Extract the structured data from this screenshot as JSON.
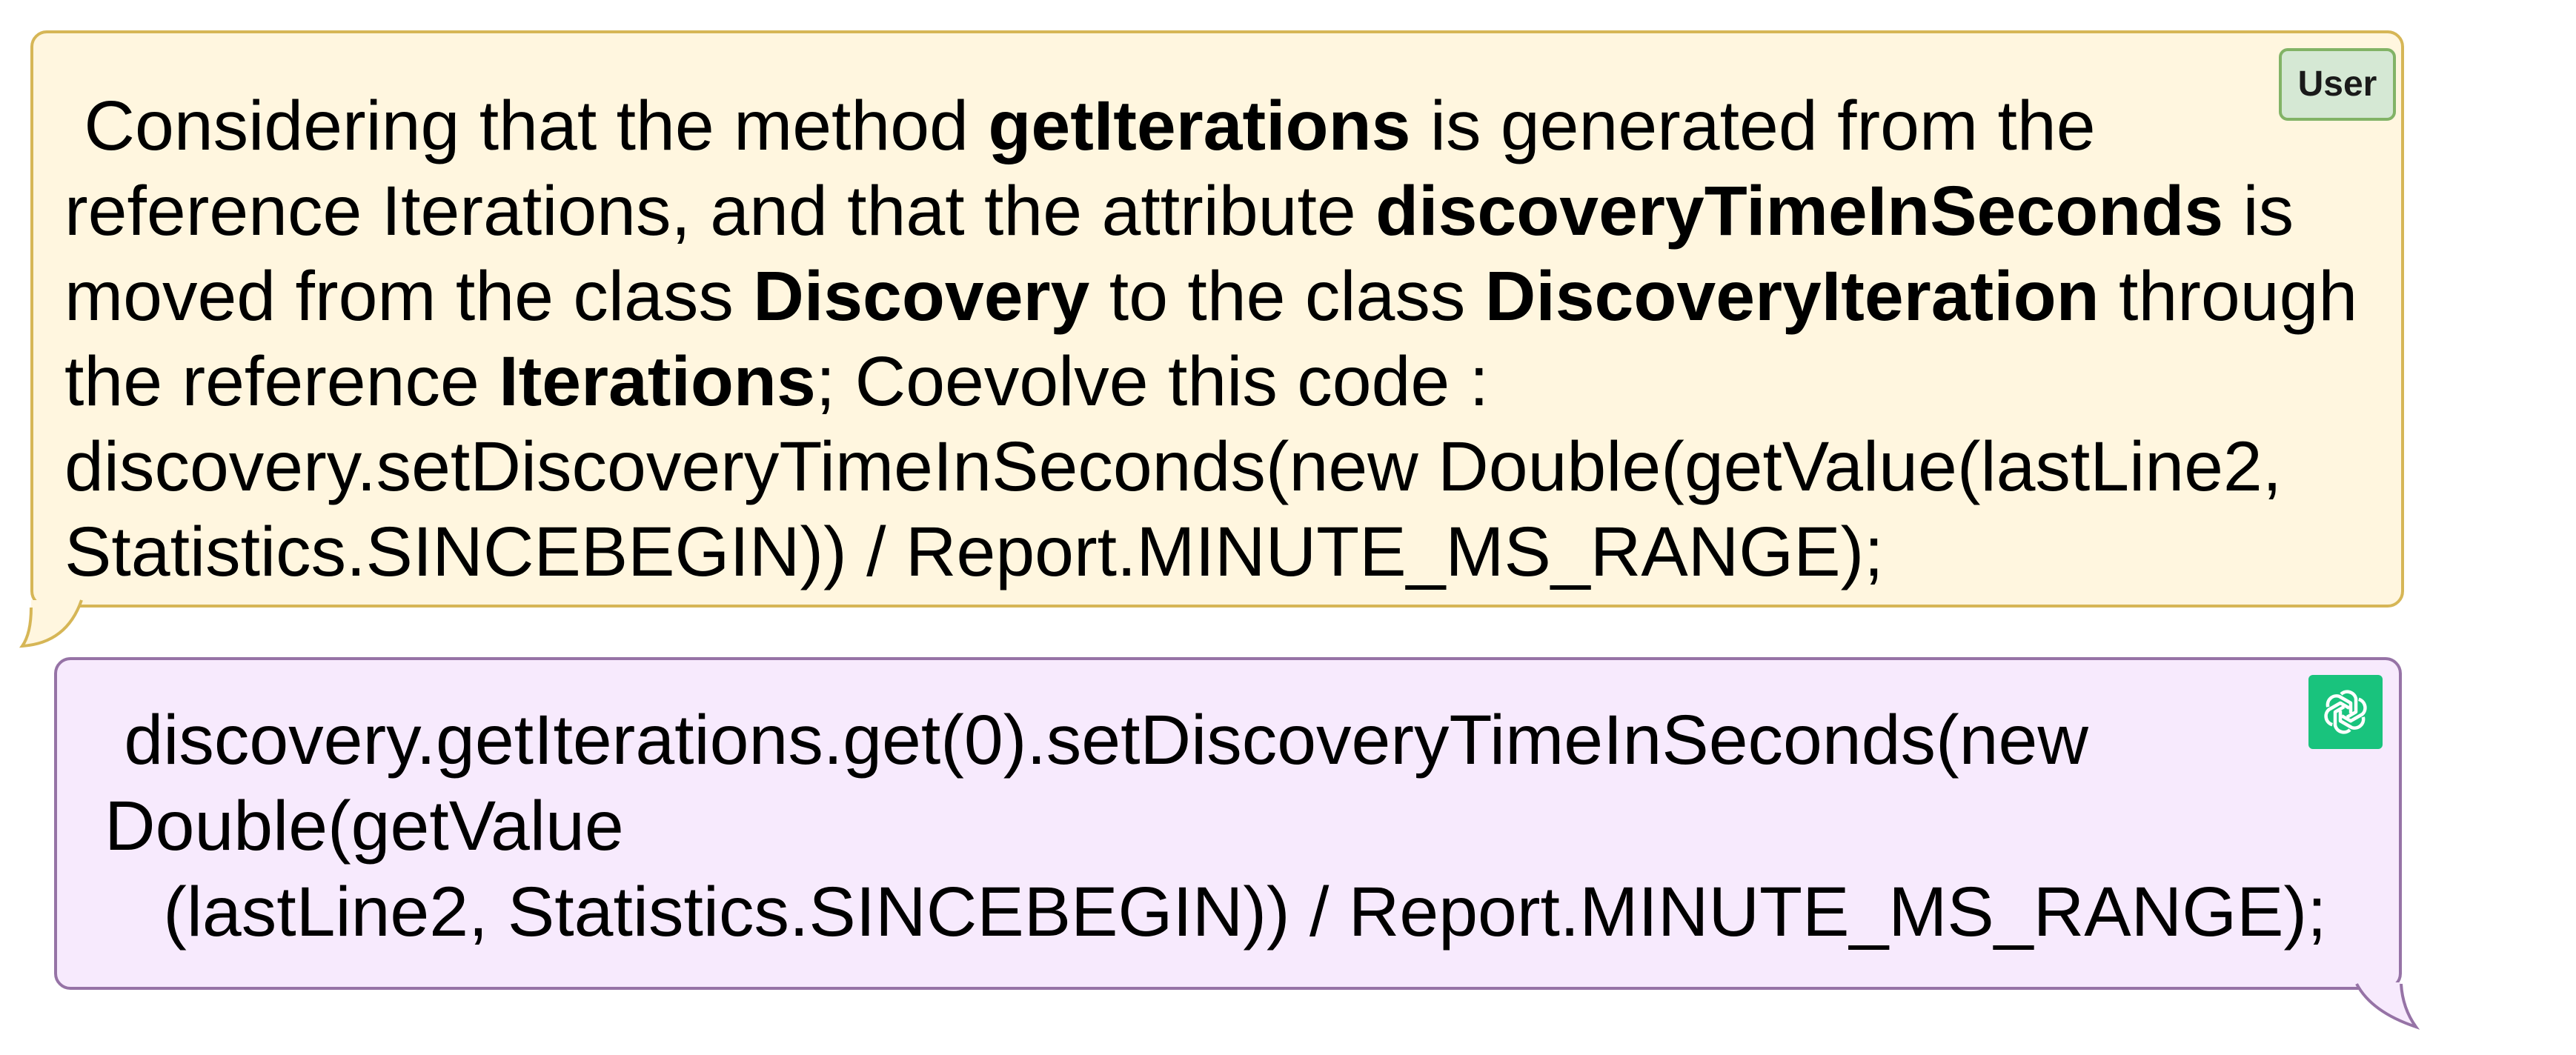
{
  "colors": {
    "user_bubble_fill": "#fff6df",
    "user_bubble_border": "#d6b656",
    "user_badge_fill": "#d5e8d4",
    "user_badge_border": "#82b366",
    "assistant_bubble_fill": "#f7eafd",
    "assistant_bubble_border": "#9673a6",
    "assistant_badge_fill": "#19c37d"
  },
  "user_message": {
    "badge_label": "User",
    "segments": [
      {
        "text": " Considering that the method ",
        "bold": false
      },
      {
        "text": "getIterations",
        "bold": true
      },
      {
        "text": " is generated from the reference Iterations, and that the attribute ",
        "bold": false
      },
      {
        "text": "discoveryTimeInSeconds",
        "bold": true
      },
      {
        "text": " is moved from the class ",
        "bold": false
      },
      {
        "text": "Discovery",
        "bold": true
      },
      {
        "text": " to the class ",
        "bold": false
      },
      {
        "text": "DiscoveryIteration",
        "bold": true
      },
      {
        "text": " through the reference ",
        "bold": false
      },
      {
        "text": "Iterations",
        "bold": true
      },
      {
        "text": "; Coevolve this code : discovery.setDiscoveryTimeInSeconds(new Double(getValue(lastLine2, Statistics.SINCEBEGIN)) / Report.MINUTE_MS_RANGE);",
        "bold": false
      }
    ]
  },
  "assistant_message": {
    "badge_icon": "chatgpt-logo-icon",
    "text": " discovery.getIterations.get(0).setDiscoveryTimeInSeconds(new\nDouble(getValue\n   (lastLine2, Statistics.SINCEBEGIN)) / Report.MINUTE_MS_RANGE);"
  }
}
